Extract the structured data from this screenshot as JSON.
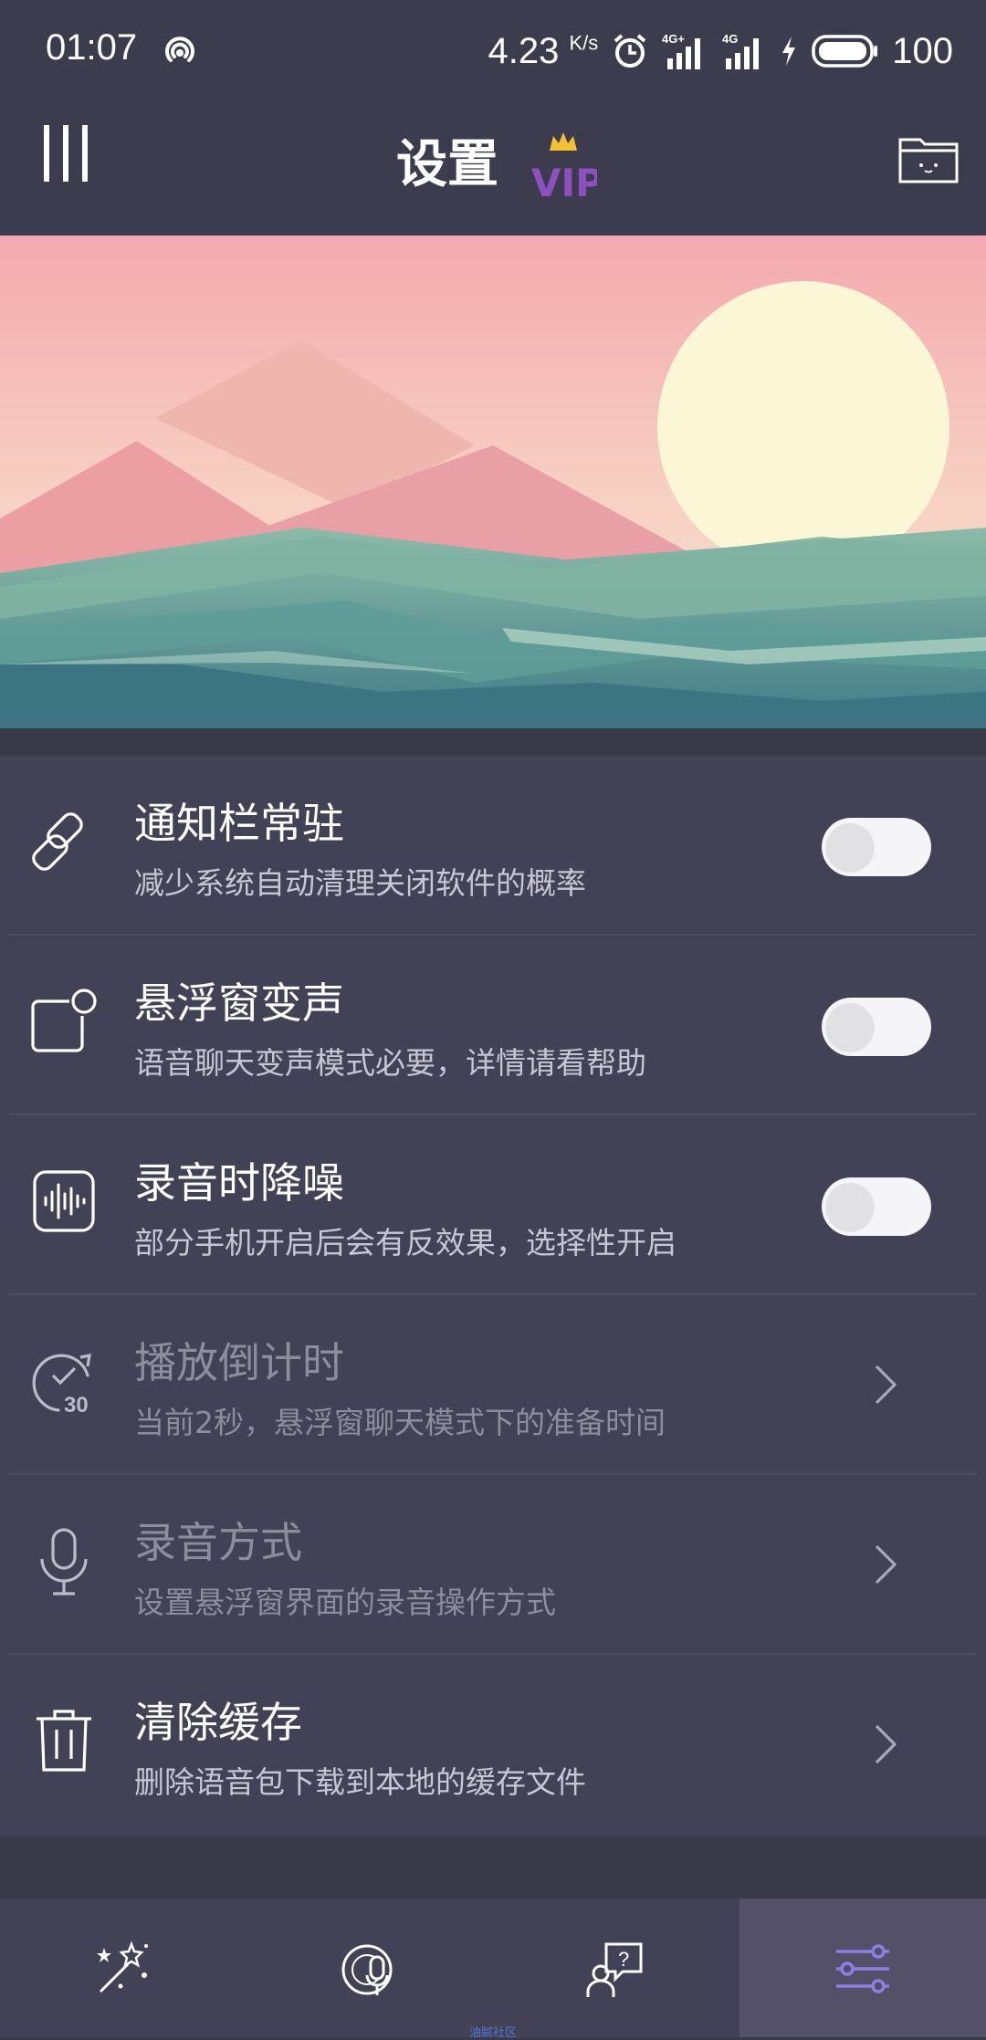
{
  "status_bar": {
    "time": "01:07",
    "speed": "4.23",
    "speed_unit": "K/s",
    "battery": "100",
    "icons": [
      "hotspot-icon",
      "alarm-icon",
      "signal-4g-plus-icon",
      "signal-4g-icon",
      "charging-icon",
      "battery-icon"
    ]
  },
  "header": {
    "title": "设置",
    "vip_label": "VIP",
    "left_icon": "menu-icon",
    "right_icon": "folder-icon"
  },
  "settings": [
    {
      "key": "notify",
      "label": "通知栏常驻",
      "sub": "减少系统自动清理关闭软件的概率",
      "control": "toggle",
      "on": false,
      "enabled": true,
      "icon": "link-icon"
    },
    {
      "key": "float",
      "label": "悬浮窗变声",
      "sub": "语音聊天变声模式必要，详情请看帮助",
      "control": "toggle",
      "on": false,
      "enabled": true,
      "icon": "floating-window-icon"
    },
    {
      "key": "denoise",
      "label": "录音时降噪",
      "sub": "部分手机开启后会有反效果，选择性开启",
      "control": "toggle",
      "on": false,
      "enabled": true,
      "icon": "waveform-icon"
    },
    {
      "key": "countdown",
      "label": "播放倒计时",
      "sub": "当前2秒，悬浮窗聊天模式下的准备时间",
      "control": "chevron",
      "enabled": false,
      "icon": "timer-icon",
      "icon_text": "30"
    },
    {
      "key": "record_mode",
      "label": "录音方式",
      "sub": "设置悬浮窗界面的录音操作方式",
      "control": "chevron",
      "enabled": false,
      "icon": "microphone-icon"
    },
    {
      "key": "clear_cache",
      "label": "清除缓存",
      "sub": "删除语音包下载到本地的缓存文件",
      "control": "chevron",
      "enabled": true,
      "icon": "trash-icon"
    }
  ],
  "bottom_nav": {
    "items": [
      "magic-wand-icon",
      "voice-disc-icon",
      "help-chat-icon",
      "settings-sliders-icon"
    ],
    "active_index": 3,
    "caption": "油腻社区"
  },
  "colors": {
    "background": "#3b3a4c",
    "list_bg": "#434155",
    "accent": "#8d7fe6",
    "vip": "#8e4fc0",
    "crown": "#f2c230"
  }
}
